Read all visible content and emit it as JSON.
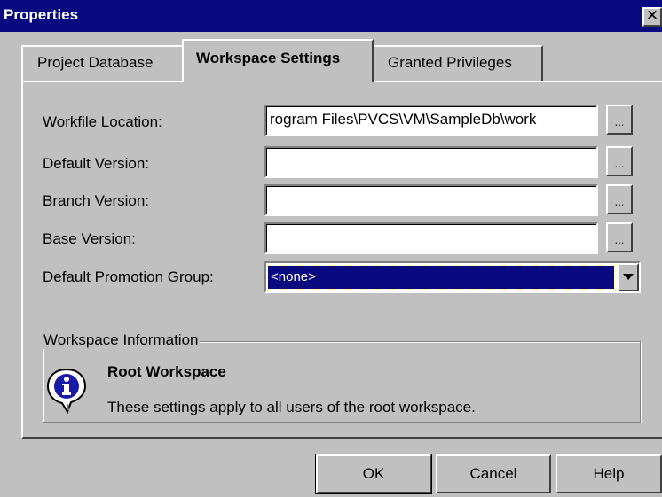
{
  "window": {
    "title": "Properties",
    "close_glyph": "✕"
  },
  "tabs": [
    {
      "label": "Project Database",
      "selected": false
    },
    {
      "label": "Workspace Settings",
      "selected": true
    },
    {
      "label": "Granted Privileges",
      "selected": false
    }
  ],
  "fields": {
    "workfile_location": {
      "label": "Workfile Location:",
      "value": "rogram Files\\PVCS\\VM\\SampleDb\\work"
    },
    "default_version": {
      "label": "Default Version:",
      "value": ""
    },
    "branch_version": {
      "label": "Branch Version:",
      "value": ""
    },
    "base_version": {
      "label": "Base Version:",
      "value": ""
    },
    "default_promotion_group": {
      "label": "Default Promotion Group:",
      "value": "<none>"
    }
  },
  "browse_label": "...",
  "workspace_info": {
    "group_title": "Workspace Information",
    "icon": "info-icon",
    "heading": "Root Workspace",
    "text": "These settings apply to all users of the root workspace."
  },
  "buttons": {
    "ok": "OK",
    "cancel": "Cancel",
    "help": "Help"
  },
  "colors": {
    "title_bar": "#0a0a80",
    "face": "#c0c0c0",
    "selection": "#0a0a80"
  }
}
